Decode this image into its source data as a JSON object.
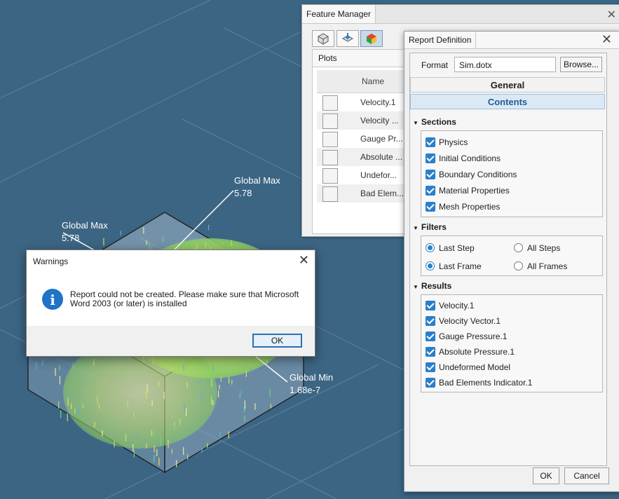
{
  "viewport": {
    "labels": [
      {
        "title": "Global Max",
        "value": "5.78"
      },
      {
        "title": "Global Max",
        "value": "5.78"
      },
      {
        "title": "Global Min",
        "value": "1.68e-7"
      }
    ]
  },
  "feature_manager": {
    "title": "Feature Manager",
    "tab_label": "Plots",
    "column_header": "Name",
    "toolbar_icons": [
      "part-icon",
      "import-icon",
      "simulation-icon"
    ],
    "plots": [
      {
        "label": "Velocity.1",
        "icon": "contour-plot-icon"
      },
      {
        "label": "Velocity ...",
        "icon": "vector-plot-icon"
      },
      {
        "label": "Gauge Pr...",
        "icon": "contour-plot-icon"
      },
      {
        "label": "Absolute ...",
        "icon": "contour-plot-icon"
      },
      {
        "label": "Undefor...",
        "icon": "contour-plot-icon"
      },
      {
        "label": "Bad Elem...",
        "icon": "contour-plot-icon"
      }
    ]
  },
  "report_definition": {
    "title": "Report Definition",
    "format_label": "Format",
    "format_value": "Sim.dotx",
    "browse_label": "Browse...",
    "general_label": "General",
    "contents_label": "Contents",
    "sections_header": "Sections",
    "sections": [
      "Physics",
      "Initial Conditions",
      "Boundary Conditions",
      "Material Properties",
      "Mesh Properties"
    ],
    "filters_header": "Filters",
    "filters": {
      "last_step": "Last Step",
      "all_steps": "All Steps",
      "last_frame": "Last Frame",
      "all_frames": "All Frames"
    },
    "results_header": "Results",
    "results": [
      "Velocity.1",
      "Velocity Vector.1",
      "Gauge Pressure.1",
      "Absolute Pressure.1",
      "Undeformed Model",
      "Bad Elements Indicator.1"
    ],
    "ok_label": "OK",
    "cancel_label": "Cancel"
  },
  "warnings_dialog": {
    "title": "Warnings",
    "message": "Report could not be created. Please make sure that Microsoft Word 2003 (or later) is installed",
    "ok_label": "OK"
  },
  "colors": {
    "viewport_bg": "#3c6584",
    "accent": "#2b7fc9",
    "contents_bar": "#dbe9f5"
  }
}
